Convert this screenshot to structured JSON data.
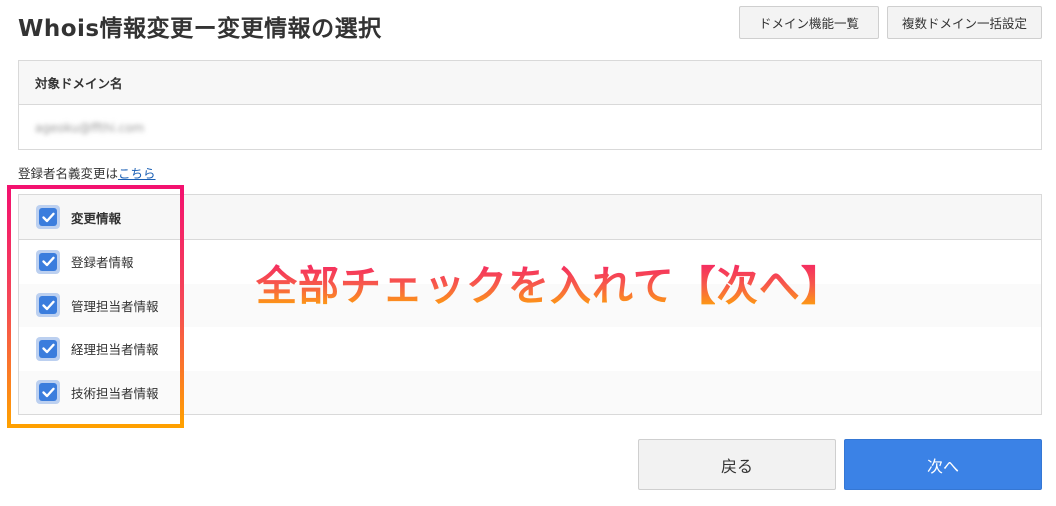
{
  "header": {
    "title": "Whois情報変更ー変更情報の選択",
    "domain_list_button": "ドメイン機能一覧",
    "bulk_settings_button": "複数ドメイン一括設定"
  },
  "domain_section": {
    "header": "対象ドメイン名",
    "value": "ageoku@ffthi.com"
  },
  "registrant_note": {
    "text": "登録者名義変更は",
    "link": "こちら"
  },
  "checklist": {
    "header": {
      "label": "変更情報",
      "checked": true
    },
    "items": [
      {
        "label": "登録者情報",
        "checked": true
      },
      {
        "label": "管理担当者情報",
        "checked": true
      },
      {
        "label": "経理担当者情報",
        "checked": true
      },
      {
        "label": "技術担当者情報",
        "checked": true
      }
    ]
  },
  "annotation": {
    "text": "全部チェックを入れて【次へ】"
  },
  "footer": {
    "back_button": "戻る",
    "next_button": "次へ"
  },
  "colors": {
    "primary_button": "#3b82e6",
    "checkbox": "#3b7ddd",
    "highlight_top": "#f3116f",
    "highlight_bottom": "#ffa000"
  }
}
